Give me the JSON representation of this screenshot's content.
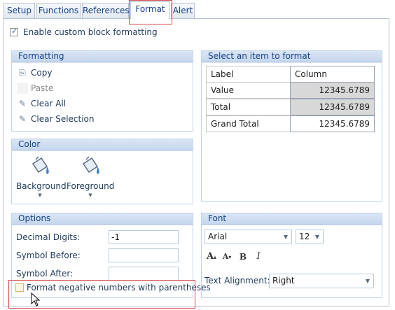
{
  "tabs": [
    {
      "label": "Setup"
    },
    {
      "label": "Functions"
    },
    {
      "label": "References"
    },
    {
      "label": "Format",
      "active": true
    },
    {
      "label": "Alert"
    }
  ],
  "enable_custom": {
    "label": "Enable custom block formatting",
    "checked": true
  },
  "formatting": {
    "header": "Formatting",
    "items": [
      {
        "label": "Copy",
        "icon": "copy-icon",
        "enabled": true
      },
      {
        "label": "Paste",
        "icon": "paste-icon",
        "enabled": false
      },
      {
        "label": "Clear All",
        "icon": "eraser-icon",
        "enabled": true
      },
      {
        "label": "Clear Selection",
        "icon": "eraser-icon",
        "enabled": true
      }
    ]
  },
  "color": {
    "header": "Color",
    "background_label": "Background",
    "foreground_label": "Foreground"
  },
  "select_item": {
    "header": "Select an item to format",
    "grid_header": [
      "Label",
      "Column"
    ],
    "rows": [
      {
        "label": "Value",
        "value": "12345.6789",
        "shaded": true
      },
      {
        "label": "Total",
        "value": "12345.6789",
        "shaded": true
      },
      {
        "label": "Grand Total",
        "value": "12345.6789",
        "shaded": false
      }
    ]
  },
  "options": {
    "header": "Options",
    "decimal_digits_label": "Decimal Digits:",
    "decimal_digits_value": "-1",
    "symbol_before_label": "Symbol Before:",
    "symbol_before_value": "",
    "symbol_after_label": "Symbol After:",
    "symbol_after_value": "",
    "negative_parens_label": "Format negative numbers with parentheses",
    "negative_parens_checked": false
  },
  "font": {
    "header": "Font",
    "family": "Arial",
    "size": "12",
    "text_alignment_label": "Text Alignment:",
    "text_alignment_value": "Right"
  },
  "colors": {
    "accent": "#15428b",
    "highlight_box": "#d64a4a",
    "group_fill": "#c6d7ee"
  }
}
